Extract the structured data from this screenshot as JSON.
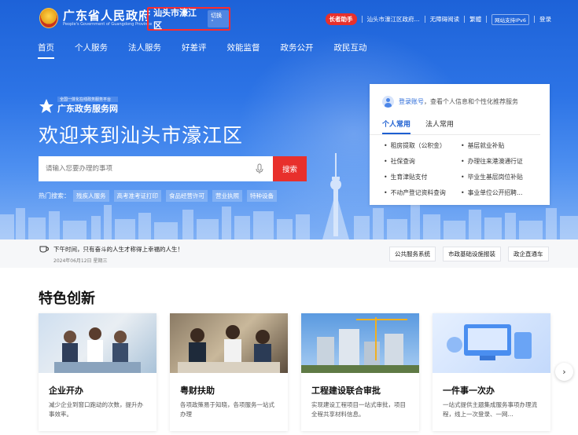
{
  "header": {
    "site_title": "广东省人民政府",
    "site_subtitle": "People's Government of Guangdong Province",
    "city": "汕头市濠江区",
    "switch_label": "切换",
    "assistant": "长者助手",
    "current_site": "汕头市濠江区政府...",
    "accessibility": "无障碍阅读",
    "traditional": "繁體",
    "ipv6": "网站支持IPv6",
    "login": "登录"
  },
  "nav": [
    "首页",
    "个人服务",
    "法人服务",
    "好差评",
    "效能监督",
    "政务公开",
    "政民互动"
  ],
  "hero": {
    "service_tagline": "全国一体化在线政务服务平台",
    "service_name": "广东政务服务网",
    "welcome": "欢迎来到汕头市濠江区",
    "search_placeholder": "请输入您要办理的事项",
    "search_button": "搜索",
    "hot_label": "热门搜索：",
    "hot_tags": [
      "残疾人服务",
      "高考准考证打印",
      "食品经营许可",
      "营业执照",
      "特种设备"
    ]
  },
  "login_card": {
    "login_link": "登录账号",
    "login_tip": "，查看个人信息和个性化推荐服务",
    "tabs": [
      "个人常用",
      "法人常用"
    ],
    "links": [
      "租房提取（公积金）",
      "基层就业补贴",
      "社保查询",
      "办理往来港澳通行证",
      "生育津贴支付",
      "毕业生基层岗位补贴",
      "不动产登记资料查询",
      "事业单位公开招聘..."
    ]
  },
  "notice": {
    "text": "下午时间，只有奋斗的人生才称得上幸福的人生！",
    "date": "2024年06月12日 星期三",
    "quick_links": [
      "公共服务系统",
      "市政基础设施报装",
      "政企直通车"
    ]
  },
  "featured": {
    "title": "特色创新",
    "cards": [
      {
        "title": "企业开办",
        "desc": "减少企业到窗口跑动的次数，提升办事效率。"
      },
      {
        "title": "粤财扶助",
        "desc": "各项政策易于知晓，各项服务一站式办理"
      },
      {
        "title": "工程建设联合审批",
        "desc": "实现建设工程项目一站式审批，项目全程共享材料信息。"
      },
      {
        "title": "一件事一次办",
        "desc": "一站式提供主题集成服务事项办理流程，线上一次登录、一网..."
      }
    ],
    "next": "›"
  },
  "colors": {
    "primary_blue": "#1d62d8",
    "accent_red": "#e8302c",
    "highlight_border": "#ff2b2b"
  }
}
